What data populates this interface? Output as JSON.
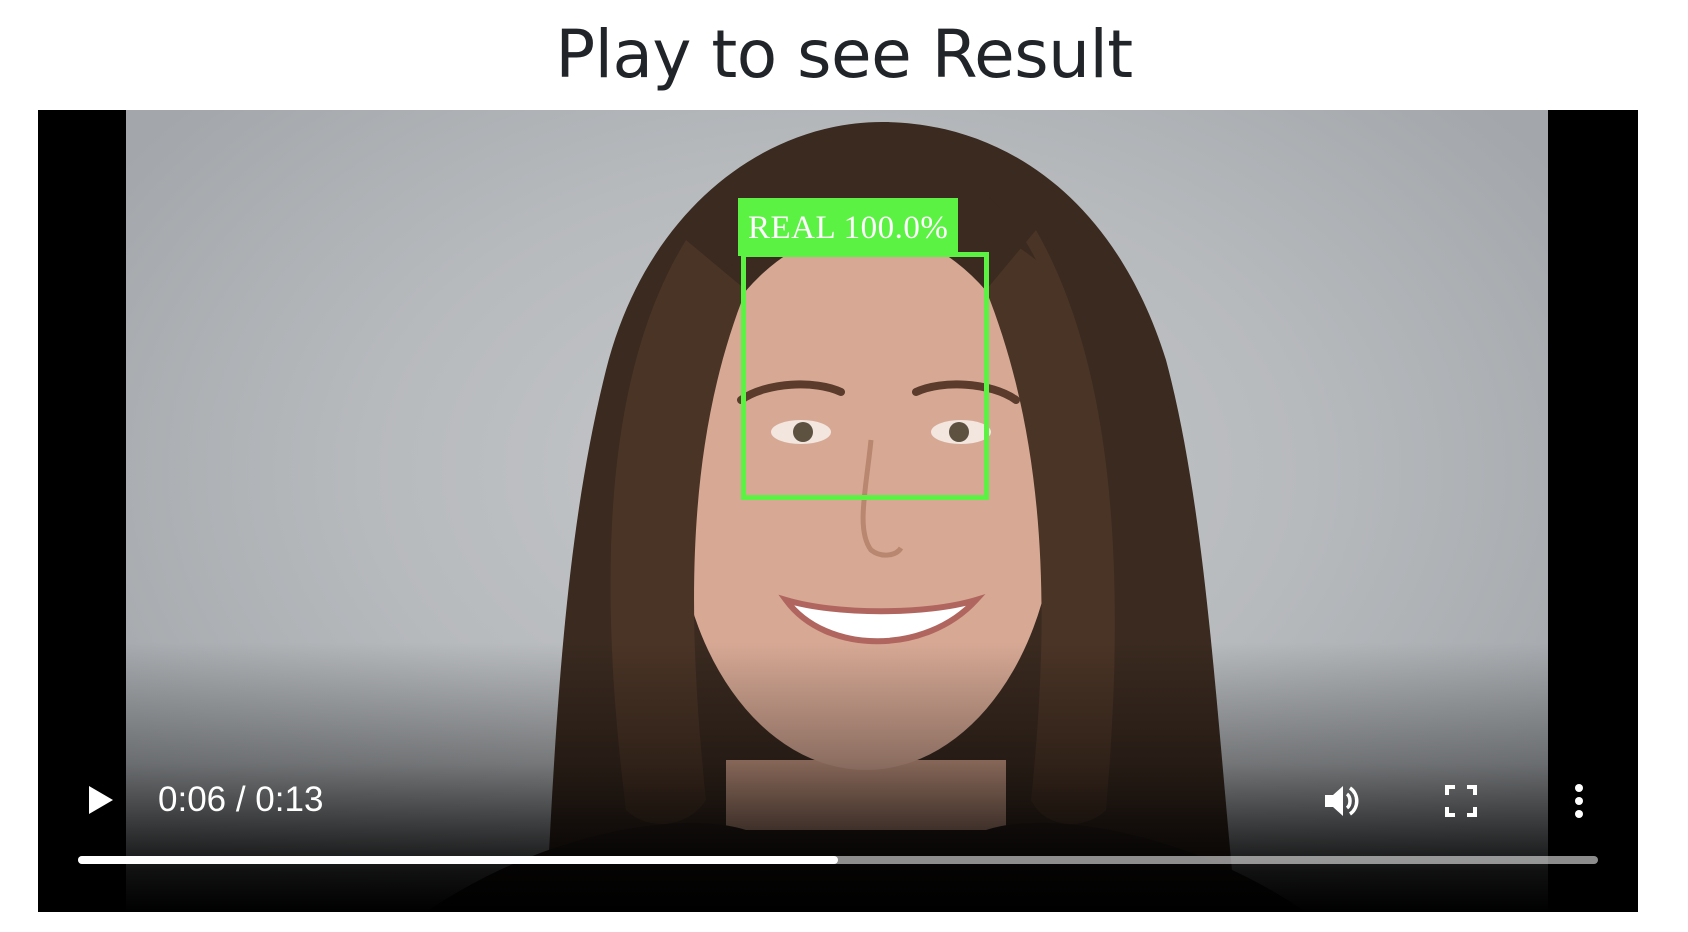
{
  "page": {
    "title": "Play to see Result"
  },
  "video": {
    "detection": {
      "label": "REAL  100.0%",
      "color": "#5cf243"
    },
    "controls": {
      "time": "0:06 / 0:13",
      "progress_fraction": 0.5,
      "play_icon": "play-icon",
      "volume_icon": "volume-icon",
      "fullscreen_icon": "fullscreen-icon",
      "more_icon": "more-vertical-icon"
    }
  }
}
